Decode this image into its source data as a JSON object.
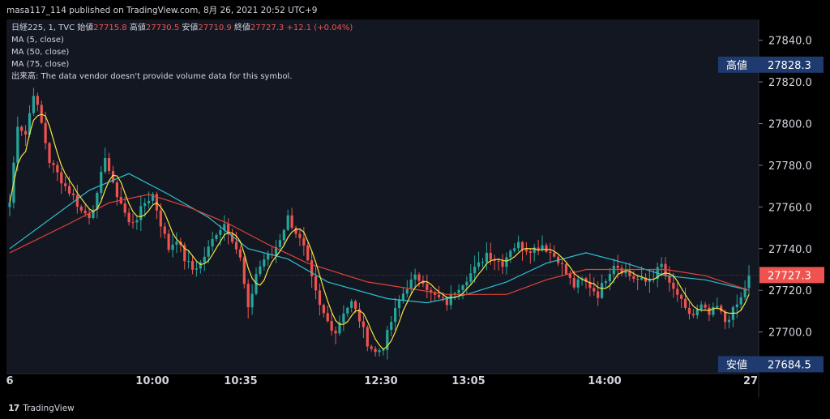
{
  "header": {
    "publish_line": "masa117_114 published on TradingView.com, 8月 26, 2021 20:52 UTC+9"
  },
  "legend": {
    "symbol": "日経225, 1, TVC",
    "open_label": "始値",
    "open": "27715.8",
    "high_label": "高値",
    "high": "27730.5",
    "low_label": "安値",
    "low": "27710.9",
    "close_label": "終値",
    "close": "27727.3",
    "change": "+12.1 (+0.04%)",
    "ma5": "MA (5, close)",
    "ma50": "MA (50, close)",
    "ma75": "MA (75, close)",
    "volume": "出来高: The data vendor doesn't provide volume data for this symbol."
  },
  "footer": {
    "brand": "TradingView"
  },
  "colors": {
    "up": "#26a69a",
    "down": "#ef5350",
    "ma5": "#f5e542",
    "ma50": "#2ec1cf",
    "ma75": "#e0423a",
    "label_bg": "#1e3a6e",
    "price_bg": "#ef5350",
    "text": "#d1d4dc",
    "grid": "#1f2330"
  },
  "chart_data": {
    "type": "candlestick",
    "symbol": "日経225",
    "interval": "1",
    "ylim": [
      27680,
      27850
    ],
    "y_ticks": [
      27700,
      27720,
      27740,
      27760,
      27780,
      27800,
      27820,
      27840
    ],
    "y_tick_labels": [
      "27700.0",
      "27720.0",
      "27740.0",
      "27760.0",
      "27780.0",
      "27800.0",
      "27820.0",
      "27840.0"
    ],
    "x_tick_labels": [
      "6",
      "10:00",
      "10:35",
      "12:30",
      "13:05",
      "14:00",
      "27"
    ],
    "grid": false,
    "y_axis_side": "right",
    "markers": [
      {
        "label": "高値",
        "value": 27828.3,
        "text": "27828.3"
      },
      {
        "label": "安値",
        "value": 27684.5,
        "text": "27684.5"
      }
    ],
    "last_price": {
      "value": 27727.3,
      "text": "27727.3"
    },
    "close_path": [
      [
        0,
        27762
      ],
      [
        2,
        27800
      ],
      [
        4,
        27795
      ],
      [
        6,
        27815
      ],
      [
        8,
        27800
      ],
      [
        10,
        27782
      ],
      [
        12,
        27776
      ],
      [
        14,
        27770
      ],
      [
        16,
        27765
      ],
      [
        18,
        27758
      ],
      [
        20,
        27756
      ],
      [
        22,
        27765
      ],
      [
        24,
        27785
      ],
      [
        26,
        27770
      ],
      [
        28,
        27762
      ],
      [
        30,
        27752
      ],
      [
        32,
        27755
      ],
      [
        34,
        27762
      ],
      [
        36,
        27766
      ],
      [
        38,
        27752
      ],
      [
        40,
        27740
      ],
      [
        42,
        27745
      ],
      [
        44,
        27735
      ],
      [
        46,
        27730
      ],
      [
        48,
        27733
      ],
      [
        50,
        27740
      ],
      [
        52,
        27748
      ],
      [
        54,
        27752
      ],
      [
        56,
        27745
      ],
      [
        58,
        27735
      ],
      [
        60,
        27710
      ],
      [
        62,
        27728
      ],
      [
        64,
        27735
      ],
      [
        66,
        27737
      ],
      [
        68,
        27745
      ],
      [
        70,
        27755
      ],
      [
        72,
        27748
      ],
      [
        74,
        27740
      ],
      [
        76,
        27725
      ],
      [
        78,
        27712
      ],
      [
        80,
        27705
      ],
      [
        82,
        27700
      ],
      [
        84,
        27710
      ],
      [
        86,
        27714
      ],
      [
        88,
        27706
      ],
      [
        90,
        27695
      ],
      [
        92,
        27690
      ],
      [
        94,
        27693
      ],
      [
        96,
        27705
      ],
      [
        98,
        27715
      ],
      [
        100,
        27722
      ],
      [
        102,
        27726
      ],
      [
        104,
        27725
      ],
      [
        106,
        27718
      ],
      [
        108,
        27716
      ],
      [
        110,
        27714
      ],
      [
        112,
        27720
      ],
      [
        114,
        27724
      ],
      [
        116,
        27728
      ],
      [
        118,
        27732
      ],
      [
        120,
        27738
      ],
      [
        122,
        27735
      ],
      [
        124,
        27733
      ],
      [
        126,
        27740
      ],
      [
        128,
        27742
      ],
      [
        130,
        27740
      ],
      [
        132,
        27740
      ],
      [
        134,
        27742
      ],
      [
        136,
        27738
      ],
      [
        138,
        27735
      ],
      [
        140,
        27728
      ],
      [
        142,
        27722
      ],
      [
        144,
        27725
      ],
      [
        146,
        27722
      ],
      [
        148,
        27718
      ],
      [
        150,
        27726
      ],
      [
        152,
        27733
      ],
      [
        154,
        27730
      ],
      [
        156,
        27727
      ],
      [
        158,
        27725
      ],
      [
        160,
        27724
      ],
      [
        162,
        27727
      ],
      [
        164,
        27732
      ],
      [
        166,
        27722
      ],
      [
        168,
        27718
      ],
      [
        170,
        27710
      ],
      [
        172,
        27708
      ],
      [
        174,
        27712
      ],
      [
        176,
        27708
      ],
      [
        178,
        27712
      ],
      [
        180,
        27705
      ],
      [
        182,
        27710
      ],
      [
        184,
        27716
      ],
      [
        186,
        27727
      ]
    ],
    "ma_series": [
      {
        "legend": "MA (50, close)",
        "color": "#2ec1cf",
        "points": [
          [
            0,
            27740
          ],
          [
            20,
            27768
          ],
          [
            30,
            27776
          ],
          [
            40,
            27766
          ],
          [
            50,
            27755
          ],
          [
            60,
            27740
          ],
          [
            70,
            27735
          ],
          [
            80,
            27724
          ],
          [
            95,
            27716
          ],
          [
            105,
            27714
          ],
          [
            115,
            27718
          ],
          [
            125,
            27724
          ],
          [
            135,
            27733
          ],
          [
            145,
            27738
          ],
          [
            155,
            27733
          ],
          [
            165,
            27727
          ],
          [
            175,
            27725
          ],
          [
            186,
            27720
          ]
        ]
      },
      {
        "legend": "MA (75, close)",
        "color": "#e0423a",
        "points": [
          [
            0,
            27738
          ],
          [
            15,
            27752
          ],
          [
            25,
            27762
          ],
          [
            35,
            27766
          ],
          [
            45,
            27760
          ],
          [
            55,
            27752
          ],
          [
            65,
            27742
          ],
          [
            75,
            27733
          ],
          [
            90,
            27724
          ],
          [
            110,
            27718
          ],
          [
            125,
            27718
          ],
          [
            135,
            27725
          ],
          [
            145,
            27730
          ],
          [
            155,
            27730
          ],
          [
            165,
            27730
          ],
          [
            175,
            27727
          ],
          [
            186,
            27720
          ]
        ]
      }
    ]
  }
}
